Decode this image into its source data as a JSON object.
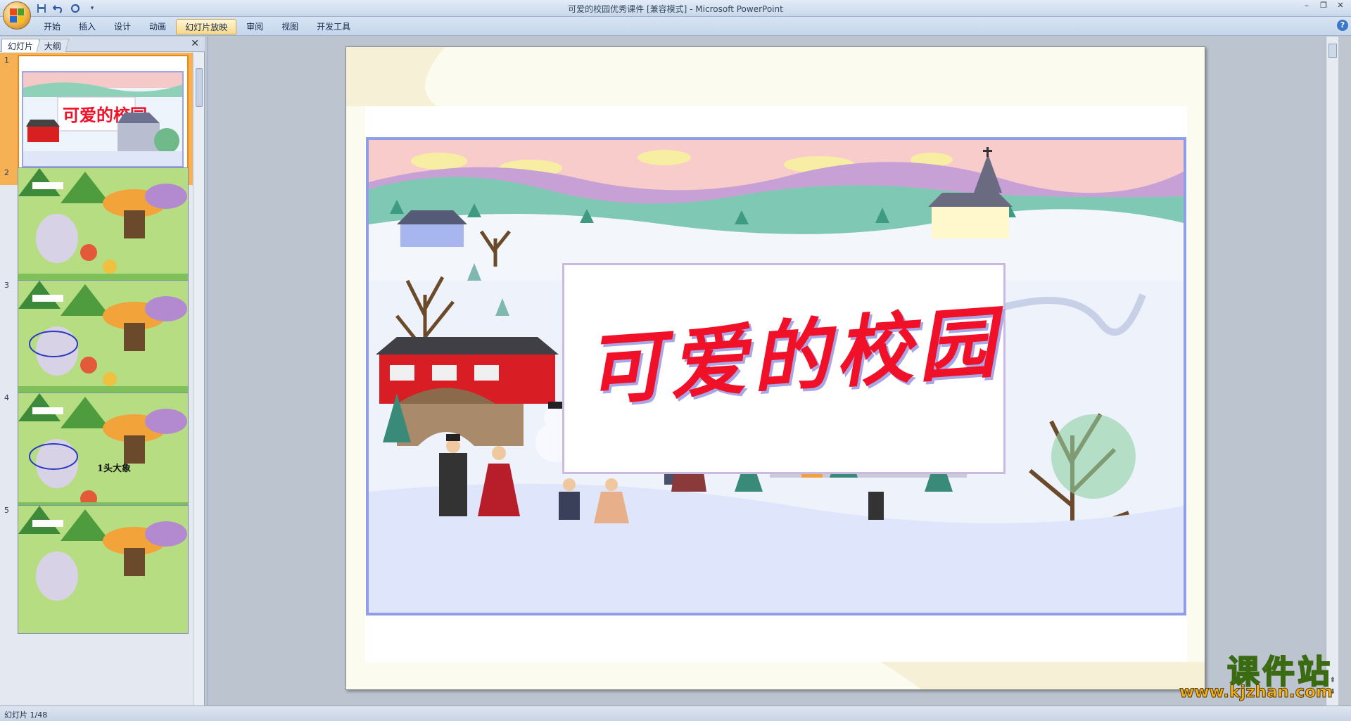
{
  "window": {
    "title": "可爱的校园优秀课件 [兼容模式] - Microsoft PowerPoint"
  },
  "quick_access": {
    "icons": [
      "save-icon",
      "undo-icon",
      "redo-icon",
      "customize-icon"
    ]
  },
  "ribbon": {
    "tabs": [
      {
        "label": "开始",
        "active": false
      },
      {
        "label": "插入",
        "active": false
      },
      {
        "label": "设计",
        "active": false
      },
      {
        "label": "动画",
        "active": false
      },
      {
        "label": "幻灯片放映",
        "active": true
      },
      {
        "label": "审阅",
        "active": false
      },
      {
        "label": "视图",
        "active": false
      },
      {
        "label": "开发工具",
        "active": false
      }
    ]
  },
  "left_panel": {
    "tab_slides": "幻灯片",
    "tab_outline": "大纲",
    "thumbnails": [
      {
        "number": "1",
        "selected": true
      },
      {
        "number": "2",
        "selected": false
      },
      {
        "number": "3",
        "selected": false
      },
      {
        "number": "4",
        "selected": false,
        "caption": "1头大象"
      },
      {
        "number": "5",
        "selected": false
      }
    ]
  },
  "slide": {
    "title": "可爱的校园",
    "colors": {
      "title": "#f01028",
      "title_shadow": "#a8a6e6",
      "frame": "#8f9ee6"
    }
  },
  "watermark": {
    "title": "课件站",
    "url": "www.kjzhan.com"
  },
  "status": {
    "text": "幻灯片 1/48"
  }
}
